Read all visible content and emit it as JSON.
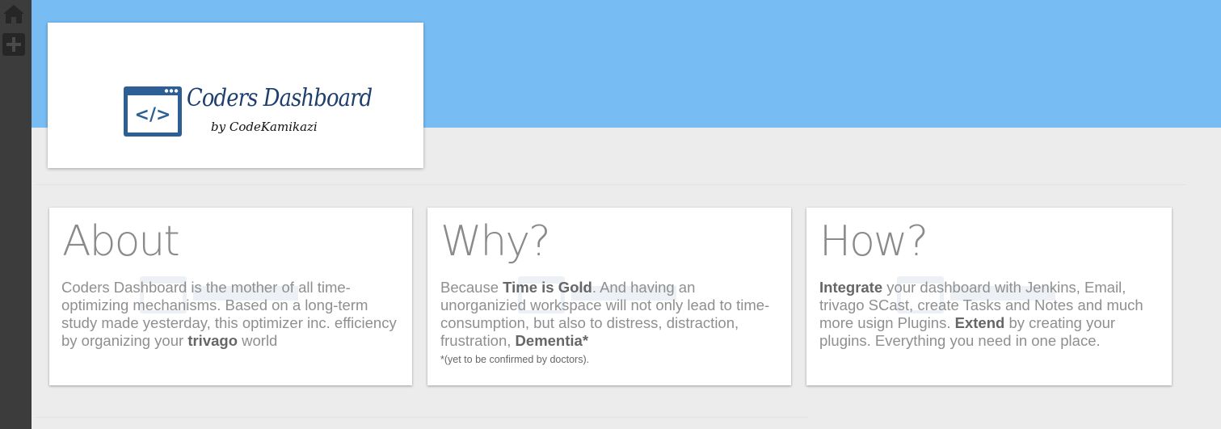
{
  "app": {
    "logo": {
      "title": "Coders Dashboard",
      "subtitle": "by CodeKamikazi",
      "icon_text": "</>"
    }
  },
  "colors": {
    "header_band": "#77bcf3",
    "sidebar": "#3c3c3c",
    "background": "#ececec",
    "logo_navy": "#2d5f95"
  },
  "sidebar": {
    "items": [
      {
        "icon": "home-icon"
      },
      {
        "icon": "plus-icon"
      }
    ]
  },
  "cards": [
    {
      "title": "About",
      "body_pre": "Coders Dashboard is the mother of all time-optimizing mechanisms. Based on a long-term study made yesterday, this optimizer inc. efficiency by organizing your ",
      "body_bold": "trivago",
      "body_post": " world"
    },
    {
      "title": "Why?",
      "body_pre": "Because ",
      "body_bold": "Time is Gold",
      "body_mid": ". And having an unorganizied workspace will not only lead to time-consumption, but also to distress, distraction, frustration, ",
      "body_bold2": "Dementia*",
      "footnote": "*(yet to be confirmed by doctors)."
    },
    {
      "title": "How?",
      "body_bold": "Integrate",
      "body_mid": " your dashboard with Jenkins, Email, trivago SCast, create Tasks and Notes and much more usign Plugins. ",
      "body_bold2": "Extend",
      "body_post": " by creating your plugins. Everything you need in one place."
    }
  ]
}
